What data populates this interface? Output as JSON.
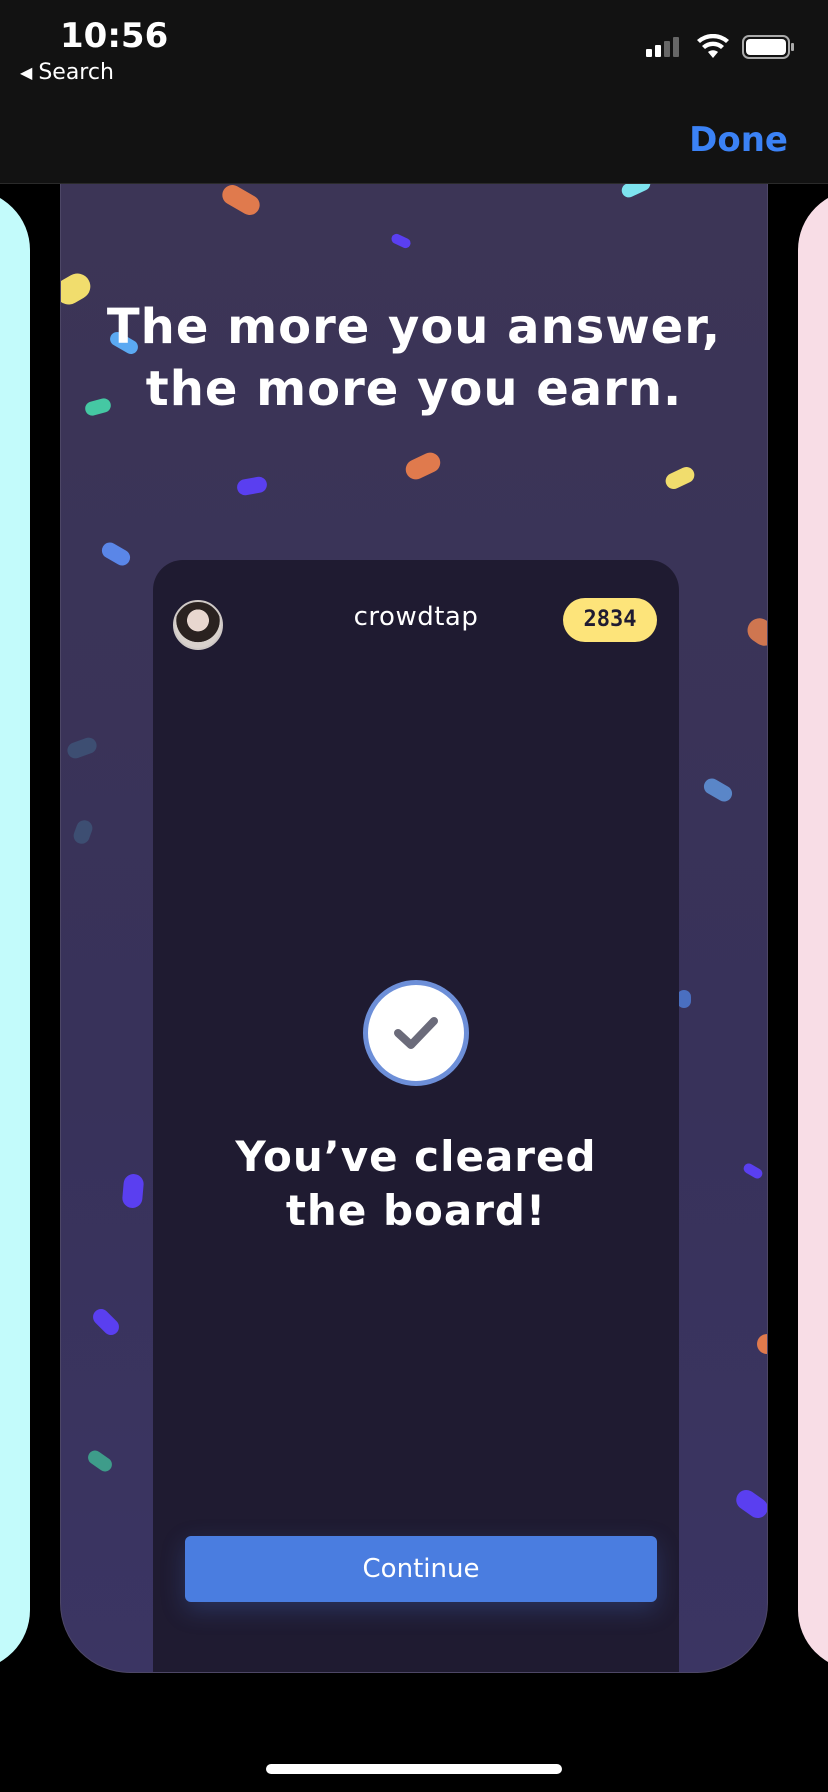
{
  "status_bar": {
    "time": "10:56",
    "back_label": "Search"
  },
  "header": {
    "done_label": "Done"
  },
  "card": {
    "headline_line1": "The more you answer,",
    "headline_line2": "the more you earn.",
    "mock_app": {
      "brand": "crowdtap",
      "points": "2834",
      "message_line1": "You’ve cleared",
      "message_line2": "the board!",
      "continue_label": "Continue"
    }
  },
  "colors": {
    "accent": "#3b82f6",
    "card_bg": "#3c3556",
    "mock_bg": "#1f1b31",
    "badge": "#fde47a",
    "button": "#4a7de0",
    "left_card": "#c3fbfb",
    "right_card": "#f8dde6"
  },
  "icons": {
    "back": "back-caret-icon",
    "signal": "signal-icon",
    "wifi": "wifi-icon",
    "battery": "battery-icon",
    "check": "checkmark-icon"
  }
}
